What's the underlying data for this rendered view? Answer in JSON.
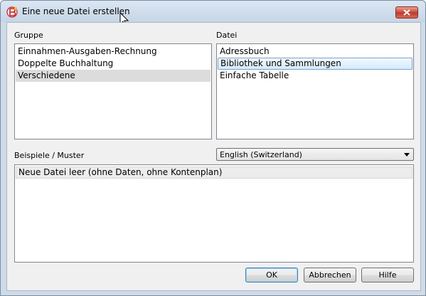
{
  "window": {
    "title": "Eine neue Datei erstellen"
  },
  "group": {
    "label": "Gruppe",
    "items": [
      "Einnahmen-Ausgaben-Rechnung",
      "Doppelte Buchhaltung",
      "Verschiedene"
    ],
    "selected_index": 2
  },
  "file": {
    "label": "Datei",
    "items": [
      "Adressbuch",
      "Bibliothek und Sammlungen",
      "Einfache Tabelle"
    ],
    "selected_index": 1
  },
  "examples": {
    "label": "Beispiele / Muster",
    "language_selected": "English (Switzerland)",
    "items": [
      "Neue Datei leer (ohne Daten, ohne Kontenplan)"
    ]
  },
  "buttons": {
    "ok": "OK",
    "cancel": "Abbrechen",
    "help": "Hilfe"
  },
  "colors": {
    "selection_border": "#7da2ce",
    "close_button": "#c8493a"
  },
  "icons": {
    "app": "banana-app-icon",
    "close": "close-icon",
    "cursor": "mouse-cursor-icon",
    "dropdown": "chevron-down-icon"
  }
}
